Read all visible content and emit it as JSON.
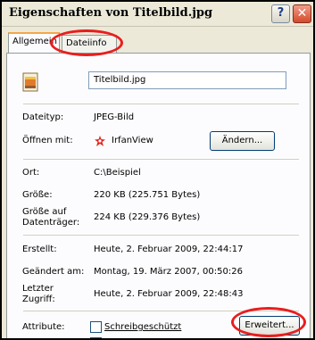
{
  "window": {
    "title": "Eigenschaften von Titelbild.jpg",
    "help_label": "?",
    "close_label": "✕"
  },
  "tabs": [
    {
      "label": "Allgemein"
    },
    {
      "label": "Dateiinfo"
    }
  ],
  "file": {
    "name": "Titelbild.jpg"
  },
  "fields": {
    "type_label": "Dateityp:",
    "type_value": "JPEG-Bild",
    "opens_label": "Öffnen mit:",
    "opens_value": "IrfanView",
    "change_button": "Ändern...",
    "location_label": "Ort:",
    "location_value": "C:\\Beispiel",
    "size_label": "Größe:",
    "size_value": "220 KB (225.751 Bytes)",
    "disk_size_label_1": "Größe auf",
    "disk_size_label_2": "Datenträger:",
    "disk_size_value": "224 KB (229.376 Bytes)",
    "created_label": "Erstellt:",
    "created_value": "Heute, 2. Februar 2009, 22:44:17",
    "modified_label": "Geändert am:",
    "modified_value": "Montag, 19. März 2007, 00:50:26",
    "accessed_label_1": "Letzter",
    "accessed_label_2": "Zugriff:",
    "accessed_value": "Heute, 2. Februar 2009, 22:48:43",
    "attributes_label": "Attribute:",
    "readonly_label": "Schreibgeschützt",
    "advanced_button": "Erweitert..."
  },
  "colors": {
    "annotation": "#e81e1e",
    "close": "#d24b2a"
  }
}
